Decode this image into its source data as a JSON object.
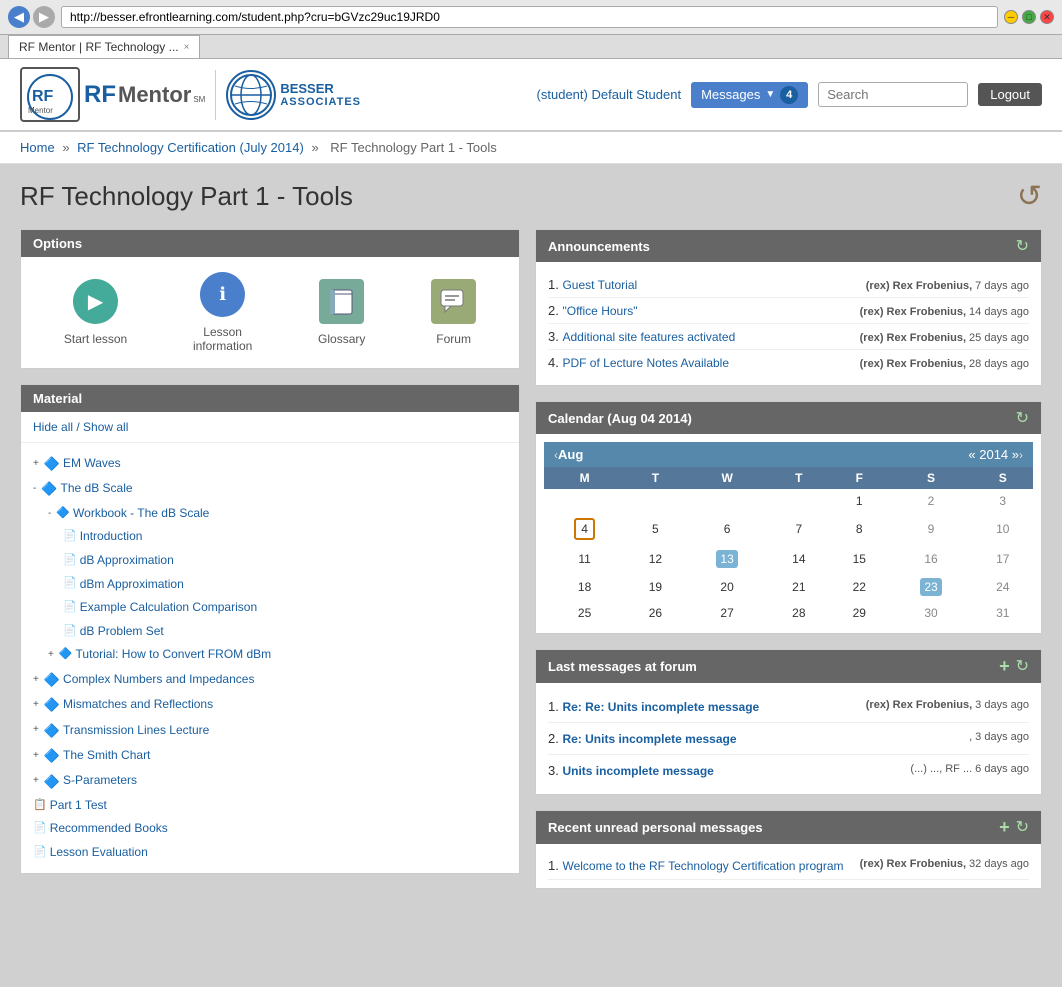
{
  "browser": {
    "url": "http://besser.efrontlearning.com/student.php?cru=bGVzc29uc19JRD0",
    "tab_title": "RF Mentor | RF Technology ...",
    "tab_close": "×"
  },
  "header": {
    "logo_rf": "RF",
    "logo_mentor": "Mentor",
    "logo_sm": "SM",
    "logo_besser_line1": "BESSER",
    "logo_besser_line2": "ASSOCIATES",
    "student_label": "(student) Default Student",
    "messages_label": "Messages",
    "messages_count": "4",
    "search_placeholder": "Search",
    "logout_label": "Logout"
  },
  "breadcrumb": {
    "home": "Home",
    "course": "RF Technology Certification (July 2014)",
    "current": "RF Technology Part 1 - Tools"
  },
  "page": {
    "title": "RF Technology Part 1 - Tools"
  },
  "options_panel": {
    "header": "Options",
    "start_lesson": "Start lesson",
    "lesson_information": "Lesson information",
    "glossary": "Glossary",
    "forum": "Forum"
  },
  "material_panel": {
    "header": "Material",
    "hide_all": "Hide all / Show all",
    "items": [
      {
        "level": 0,
        "type": "expand",
        "expand": "+",
        "icon": "folder",
        "label": "EM Waves",
        "link": true
      },
      {
        "level": 0,
        "type": "expanded",
        "expand": "-",
        "icon": "folder",
        "label": "The dB Scale",
        "link": true
      },
      {
        "level": 1,
        "type": "expanded",
        "expand": "-",
        "icon": "folder",
        "label": "Workbook - The dB Scale",
        "link": true
      },
      {
        "level": 2,
        "type": "leaf",
        "expand": "",
        "icon": "doc",
        "label": "Introduction",
        "link": true
      },
      {
        "level": 2,
        "type": "leaf",
        "expand": "",
        "icon": "doc",
        "label": "dB Approximation",
        "link": true
      },
      {
        "level": 2,
        "type": "leaf",
        "expand": "",
        "icon": "doc",
        "label": "dBm Approximation",
        "link": true
      },
      {
        "level": 2,
        "type": "leaf",
        "expand": "",
        "icon": "doc",
        "label": "Example Calculation Comparison",
        "link": true
      },
      {
        "level": 2,
        "type": "leaf",
        "expand": "",
        "icon": "doc",
        "label": "dB Problem Set",
        "link": true
      },
      {
        "level": 1,
        "type": "expand",
        "expand": "+",
        "icon": "folder",
        "label": "Tutorial: How to Convert FROM dBm",
        "link": true
      },
      {
        "level": 0,
        "type": "expand",
        "expand": "+",
        "icon": "folder",
        "label": "Complex Numbers and Impedances",
        "link": true
      },
      {
        "level": 0,
        "type": "expand",
        "expand": "+",
        "icon": "folder",
        "label": "Mismatches and Reflections",
        "link": true
      },
      {
        "level": 0,
        "type": "expand",
        "expand": "+",
        "icon": "folder",
        "label": "Transmission Lines Lecture",
        "link": true
      },
      {
        "level": 0,
        "type": "expand",
        "expand": "+",
        "icon": "folder",
        "label": "The Smith Chart",
        "link": true
      },
      {
        "level": 0,
        "type": "expand",
        "expand": "+",
        "icon": "folder",
        "label": "S-Parameters",
        "link": true
      },
      {
        "level": 0,
        "type": "leaf",
        "expand": "",
        "icon": "pdf",
        "label": "Part 1 Test",
        "link": true
      },
      {
        "level": 0,
        "type": "leaf",
        "expand": "",
        "icon": "doc",
        "label": "Recommended Books",
        "link": true
      },
      {
        "level": 0,
        "type": "leaf",
        "expand": "",
        "icon": "doc",
        "label": "Lesson Evaluation",
        "link": true
      }
    ]
  },
  "announcements_panel": {
    "header": "Announcements",
    "items": [
      {
        "num": "1.",
        "label": "Guest Tutorial",
        "author": "(rex) Rex Frobenius,",
        "time": "7 days ago"
      },
      {
        "num": "2.",
        "label": "\"Office Hours\"",
        "author": "(rex) Rex Frobenius,",
        "time": "14 days ago"
      },
      {
        "num": "3.",
        "label": "Additional site features activated",
        "author": "(rex) Rex Frobenius,",
        "time": "25 days ago"
      },
      {
        "num": "4.",
        "label": "PDF of Lecture Notes Available",
        "author": "(rex) Rex Frobenius,",
        "time": "28 days ago"
      }
    ]
  },
  "calendar": {
    "header": "Calendar (Aug 04 2014)",
    "month": "Aug",
    "year": "2014",
    "days_header": [
      "M",
      "T",
      "W",
      "T",
      "F",
      "S",
      "S"
    ],
    "weeks": [
      [
        null,
        null,
        null,
        null,
        "1",
        "2",
        "3"
      ],
      [
        "4",
        "5",
        "6",
        "7",
        "8",
        "9",
        "10"
      ],
      [
        "11",
        "12",
        "13",
        "14",
        "15",
        "16",
        "17"
      ],
      [
        "18",
        "19",
        "20",
        "21",
        "22",
        "23",
        "24"
      ],
      [
        "25",
        "26",
        "27",
        "28",
        "29",
        "30",
        "31"
      ]
    ],
    "today": "4",
    "highlighted": "13",
    "highlighted2": "23"
  },
  "forum_panel": {
    "header": "Last messages at forum",
    "items": [
      {
        "num": "1.",
        "label": "Re: Re: Units incomplete message",
        "author": "(rex) Rex Frobenius,",
        "time": "3 days ago"
      },
      {
        "num": "2.",
        "label": "Re: Units incomplete message",
        "author": "",
        "time": ", 3 days ago"
      },
      {
        "num": "3.",
        "label": "Units incomplete message",
        "author": "(... ...) ..., RF ...",
        "time": "6 days ago"
      }
    ]
  },
  "messages_panel": {
    "header": "Recent unread personal messages",
    "items": [
      {
        "num": "1.",
        "label": "Welcome to the RF Technology Certification program",
        "author": "(rex) Rex Frobenius,",
        "time": "32 days ago"
      }
    ]
  },
  "icons": {
    "back_arrow": "↺",
    "play": "▶",
    "info": "ℹ",
    "book": "📖",
    "forum_icon": "💬",
    "refresh": "↻",
    "add": "+",
    "prev_month": "«",
    "next_month": "»"
  }
}
